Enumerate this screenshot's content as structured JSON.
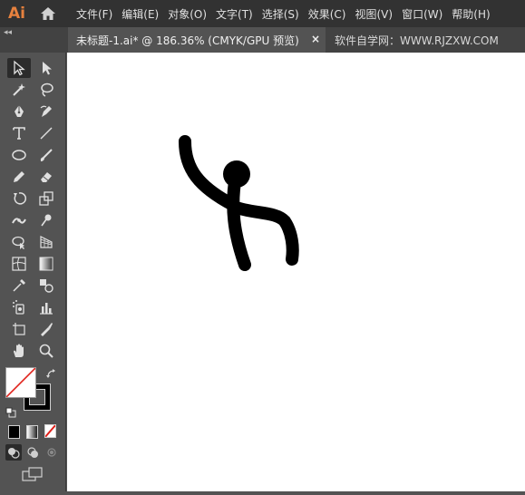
{
  "app": {
    "logo": "Ai"
  },
  "menu": {
    "items": [
      "文件(F)",
      "编辑(E)",
      "对象(O)",
      "文字(T)",
      "选择(S)",
      "效果(C)",
      "视图(V)",
      "窗口(W)",
      "帮助(H)"
    ]
  },
  "tabs": {
    "collapse": "◂◂",
    "active_title": "未标题-1.ai* @ 186.36% (CMYK/GPU 预览)",
    "close": "×",
    "second": "软件自学网：WWW.RJZXW.COM"
  },
  "colors": {
    "menubar": "#323232",
    "toolbar": "#535353",
    "accent_logo": "#e6813e",
    "canvas": "#ffffff",
    "stroke": "#000000"
  },
  "tools": [
    "selection-tool",
    "direct-selection-tool",
    "magic-wand-tool",
    "lasso-tool",
    "pen-tool",
    "curvature-tool",
    "type-tool",
    "line-segment-tool",
    "ellipse-tool",
    "paintbrush-tool",
    "pencil-tool",
    "eraser-tool",
    "rotate-tool",
    "scale-tool",
    "width-tool",
    "puppet-warp-tool",
    "shape-builder-tool",
    "perspective-grid-tool",
    "mesh-tool",
    "gradient-tool",
    "eyedropper-tool",
    "blend-tool",
    "symbol-sprayer-tool",
    "column-graph-tool",
    "artboard-tool",
    "slice-tool",
    "hand-tool",
    "zoom-tool"
  ]
}
